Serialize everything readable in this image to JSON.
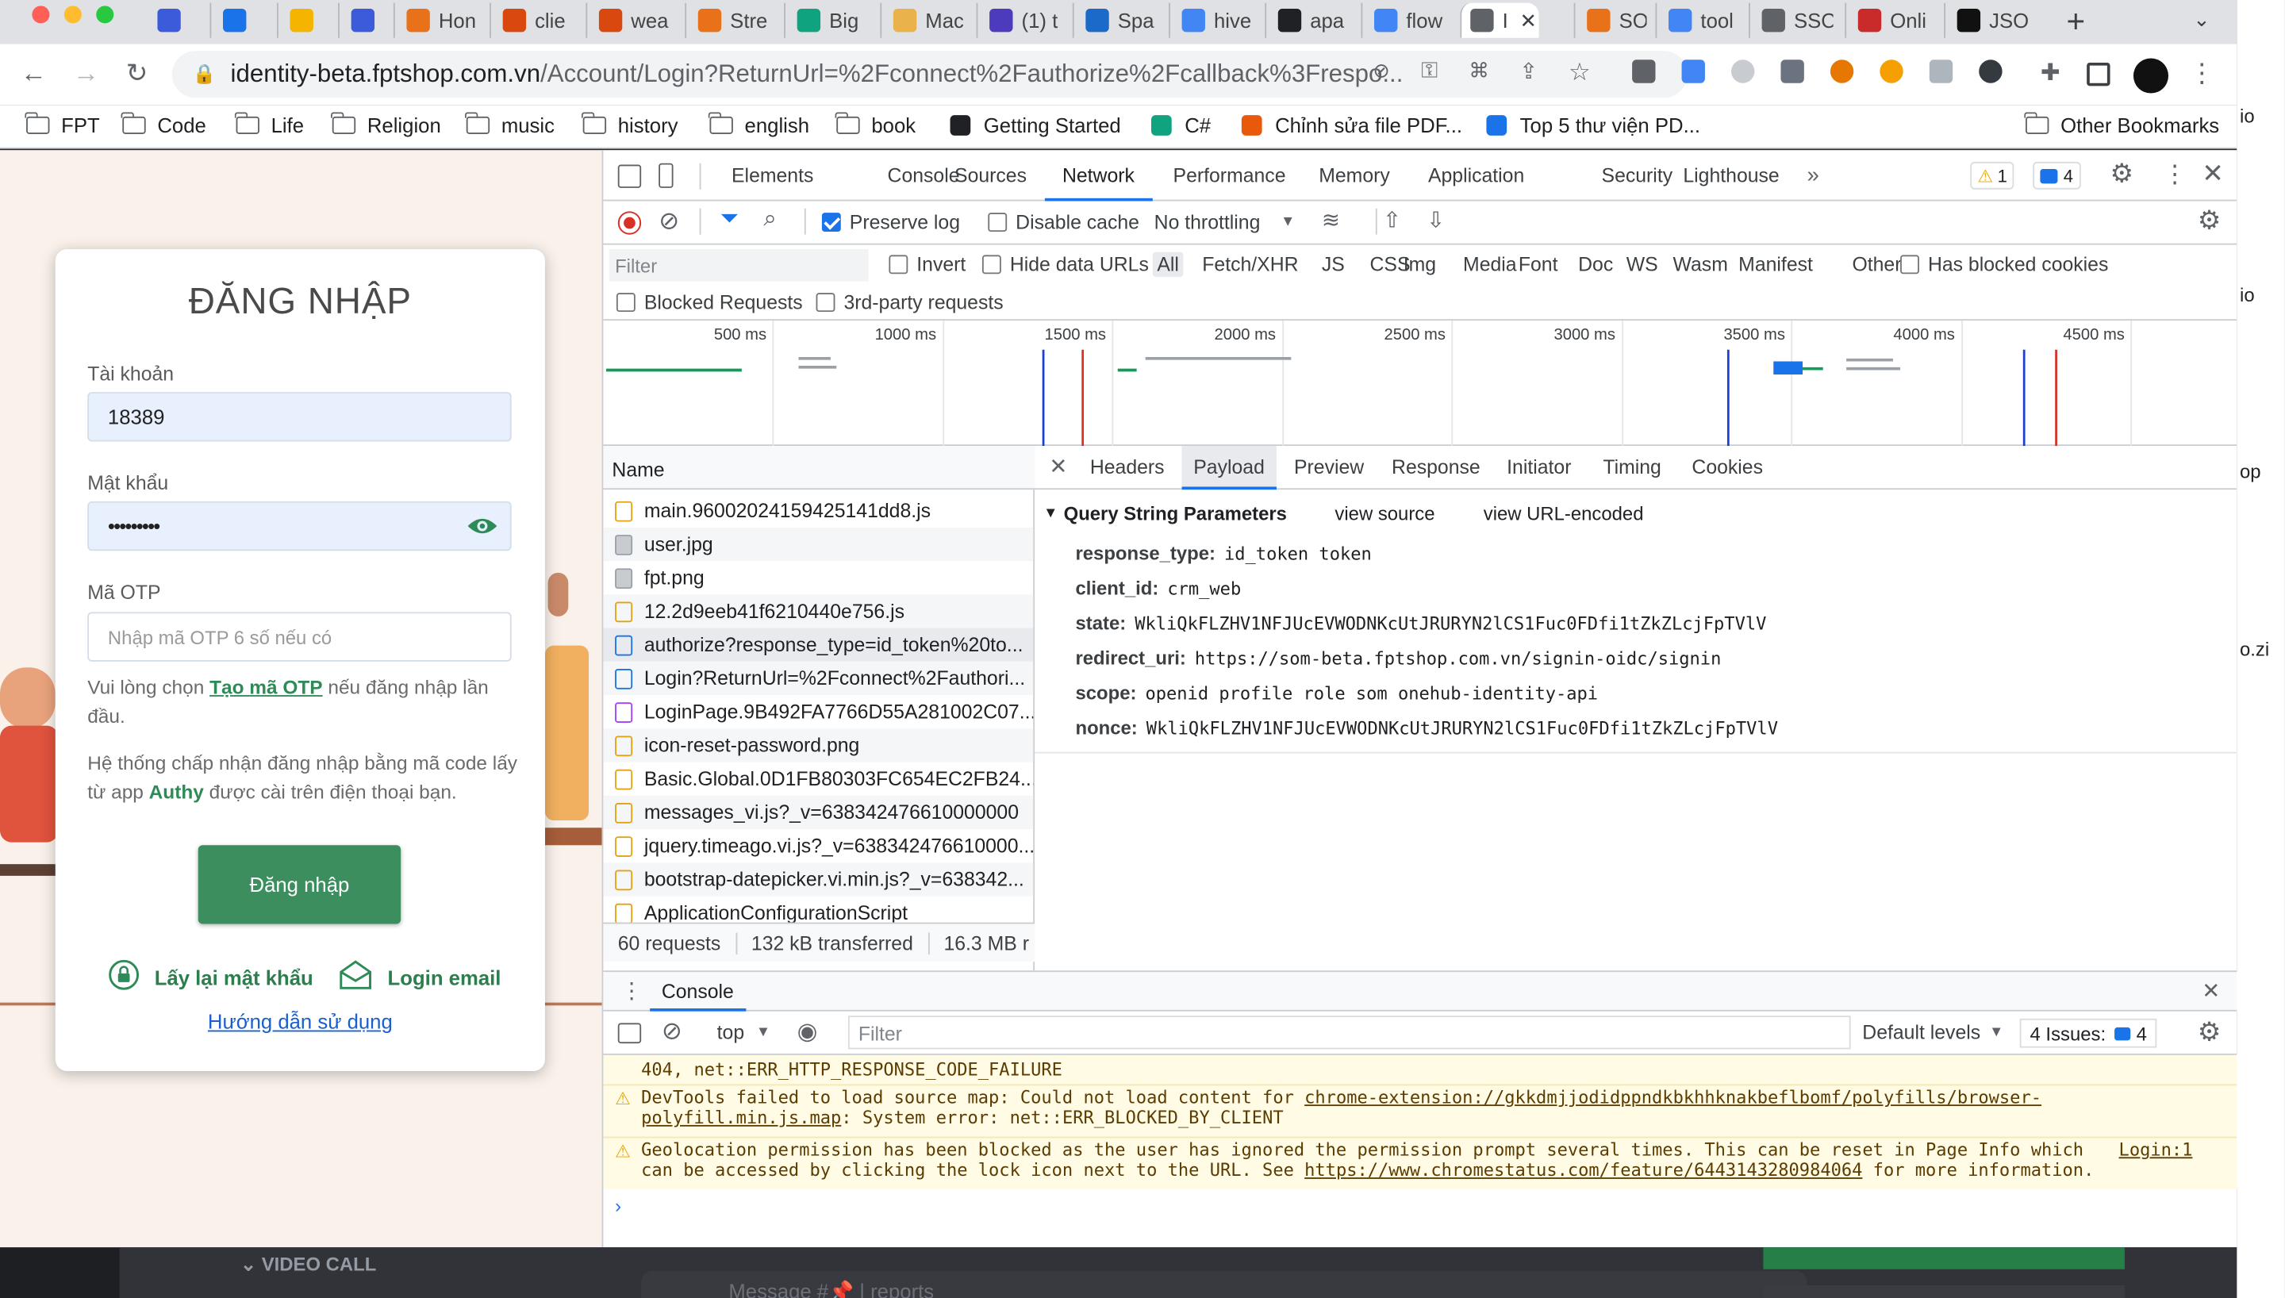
{
  "browser": {
    "tabs": [
      {
        "label": "",
        "color": "#3b5bdb"
      },
      {
        "label": "",
        "color": "#1a73e8"
      },
      {
        "label": "",
        "color": "#f4b400"
      },
      {
        "label": "",
        "color": "#3b5bdb"
      },
      {
        "label": "Hon",
        "color": "#e8711a"
      },
      {
        "label": "clie",
        "color": "#d9480f"
      },
      {
        "label": "wea",
        "color": "#d9480f"
      },
      {
        "label": "Stre",
        "color": "#e8711a"
      },
      {
        "label": "Big",
        "color": "#10a37f"
      },
      {
        "label": "Mac",
        "color": "#e9b24b"
      },
      {
        "label": "(1) t",
        "color": "#4c3cbd"
      },
      {
        "label": "Spa",
        "color": "#1b6ac9"
      },
      {
        "label": "hive",
        "color": "#4285f4"
      },
      {
        "label": "apa",
        "color": "#202124"
      },
      {
        "label": "flow",
        "color": "#4285f4"
      },
      {
        "label": "I",
        "color": "#5f6368"
      },
      {
        "label": "SON",
        "color": "#e8711a"
      },
      {
        "label": "tool",
        "color": "#4285f4"
      },
      {
        "label": "SSC",
        "color": "#5f6368"
      },
      {
        "label": "Onli",
        "color": "#c92a2a"
      },
      {
        "label": "JSO",
        "color": "#111111"
      }
    ],
    "url_host": "identity-beta.fptshop.com.vn",
    "url_path": "/Account/Login?ReturnUrl=%2Fconnect%2Fauthorize%2Fcallback%3Frespo...",
    "bookmarks": [
      {
        "label": "FPT",
        "type": "folder"
      },
      {
        "label": "Code",
        "type": "folder"
      },
      {
        "label": "Life",
        "type": "folder"
      },
      {
        "label": "Religion",
        "type": "folder"
      },
      {
        "label": "music",
        "type": "folder"
      },
      {
        "label": "history",
        "type": "folder"
      },
      {
        "label": "english",
        "type": "folder"
      },
      {
        "label": "book",
        "type": "folder"
      },
      {
        "label": "Getting Started",
        "type": "link"
      },
      {
        "label": "C#",
        "type": "link"
      },
      {
        "label": "Chỉnh sửa file PDF...",
        "type": "link"
      },
      {
        "label": "Top 5 thư viện PD...",
        "type": "link"
      }
    ],
    "other_bookmarks": "Other Bookmarks"
  },
  "login": {
    "title": "ĐĂNG NHẬP",
    "account_label": "Tài khoản",
    "account_value": "18389",
    "password_label": "Mật khẩu",
    "password_value": "•••••••••",
    "otp_label": "Mã OTP",
    "otp_placeholder": "Nhập mã OTP 6 số nếu có",
    "otp_note_pre": "Vui lòng chọn ",
    "otp_note_link": "Tạo mã OTP",
    "otp_note_post": " nếu đăng nhập lần đầu.",
    "authy_note_pre": "Hệ thống chấp nhận đăng nhập bằng mã code lấy từ app ",
    "authy_note_app": "Authy",
    "authy_note_post": " được cài trên điện thoại bạn.",
    "submit": "Đăng nhập",
    "reset_password": "Lấy lại mật khẩu",
    "login_email": "Login email",
    "guide": "Hướng dẫn sử dụng"
  },
  "devtools": {
    "tabs": [
      "Elements",
      "Console",
      "Sources",
      "Network",
      "Performance",
      "Memory",
      "Application",
      "Security",
      "Lighthouse"
    ],
    "active_tab": "Network",
    "warn_count": "1",
    "issue_count": "4",
    "preserve_log": "Preserve log",
    "disable_cache": "Disable cache",
    "throttling": "No throttling",
    "filter_placeholder": "Filter",
    "invert": "Invert",
    "hide_data_urls": "Hide data URLs",
    "filter_types": [
      "All",
      "Fetch/XHR",
      "JS",
      "CSS",
      "Img",
      "Media",
      "Font",
      "Doc",
      "WS",
      "Wasm",
      "Manifest",
      "Other"
    ],
    "has_blocked_cookies": "Has blocked cookies",
    "blocked_requests": "Blocked Requests",
    "third_party": "3rd-party requests",
    "overview_ticks": [
      "500 ms",
      "1000 ms",
      "1500 ms",
      "2000 ms",
      "2500 ms",
      "3000 ms",
      "3500 ms",
      "4000 ms",
      "4500 ms"
    ],
    "name_header": "Name",
    "requests": [
      {
        "name": "main.96002024159425141dd8.js",
        "kind": "js"
      },
      {
        "name": "user.jpg",
        "kind": "img"
      },
      {
        "name": "fpt.png",
        "kind": "img"
      },
      {
        "name": "12.2d9eeb41f6210440e756.js",
        "kind": "js"
      },
      {
        "name": "authorize?response_type=id_token%20to...",
        "kind": "doc"
      },
      {
        "name": "Login?ReturnUrl=%2Fconnect%2Fauthori...",
        "kind": "doc"
      },
      {
        "name": "LoginPage.9B492FA7766D55A281002C07...",
        "kind": "css"
      },
      {
        "name": "icon-reset-password.png",
        "kind": "js"
      },
      {
        "name": "Basic.Global.0D1FB80303FC654EC2FB24...",
        "kind": "js"
      },
      {
        "name": "messages_vi.js?_v=638342476610000000",
        "kind": "js"
      },
      {
        "name": "jquery.timeago.vi.js?_v=638342476610000...",
        "kind": "js"
      },
      {
        "name": "bootstrap-datepicker.vi.min.js?_v=638342...",
        "kind": "js"
      },
      {
        "name": "ApplicationConfigurationScript",
        "kind": "js"
      }
    ],
    "summary": [
      "60 requests",
      "132 kB transferred",
      "16.3 MB r"
    ],
    "detail_tabs": [
      "Headers",
      "Payload",
      "Preview",
      "Response",
      "Initiator",
      "Timing",
      "Cookies"
    ],
    "active_detail_tab": "Payload",
    "qs_title": "Query String Parameters",
    "view_source": "view source",
    "view_url_encoded": "view URL-encoded",
    "params": [
      {
        "key": "response_type:",
        "value": "id_token token"
      },
      {
        "key": "client_id:",
        "value": "crm_web"
      },
      {
        "key": "state:",
        "value": "WkliQkFLZHV1NFJUcEVWODNKcUtJRURYN2lCS1Fuc0FDfi1tZkZLcjFpTVlV"
      },
      {
        "key": "redirect_uri:",
        "value": "https://som-beta.fptshop.com.vn/signin-oidc/signin"
      },
      {
        "key": "scope:",
        "value": "openid profile role som onehub-identity-api"
      },
      {
        "key": "nonce:",
        "value": "WkliQkFLZHV1NFJUcEVWODNKcUtJRURYN2lCS1Fuc0FDfi1tZkZLcjFpTVlV"
      }
    ],
    "drawer_title": "Console",
    "context": "top",
    "console_filter": "Filter",
    "default_levels": "Default levels",
    "issues_label": "4 Issues:",
    "issues_count": "4",
    "console_messages": [
      {
        "text": "404, net::ERR_HTTP_RESPONSE_CODE_FAILURE",
        "partial": true
      },
      {
        "pre": "DevTools failed to load source map: Could not load content for ",
        "link": "chrome-extension://gkkdmjjodidppndkbkhhknakbeflbomf/polyfills/browser-polyfill.min.js.map",
        "post": ": System error: net::ERR_BLOCKED_BY_CLIENT"
      },
      {
        "pre": "Geolocation permission has been blocked as the user has ignored the permission prompt several times. This can be reset in Page Info which can be accessed by clicking the lock icon next to the URL. See ",
        "link": "https://www.chromestatus.com/feature/6443143280984064",
        "post": " for more information.",
        "source": "Login:1"
      }
    ]
  },
  "background": {
    "video_call": "VIDEO CALL",
    "message_placeholder": "Message #📌 | reports",
    "right_strip": [
      "io",
      "io",
      "op",
      "o.zi"
    ]
  }
}
